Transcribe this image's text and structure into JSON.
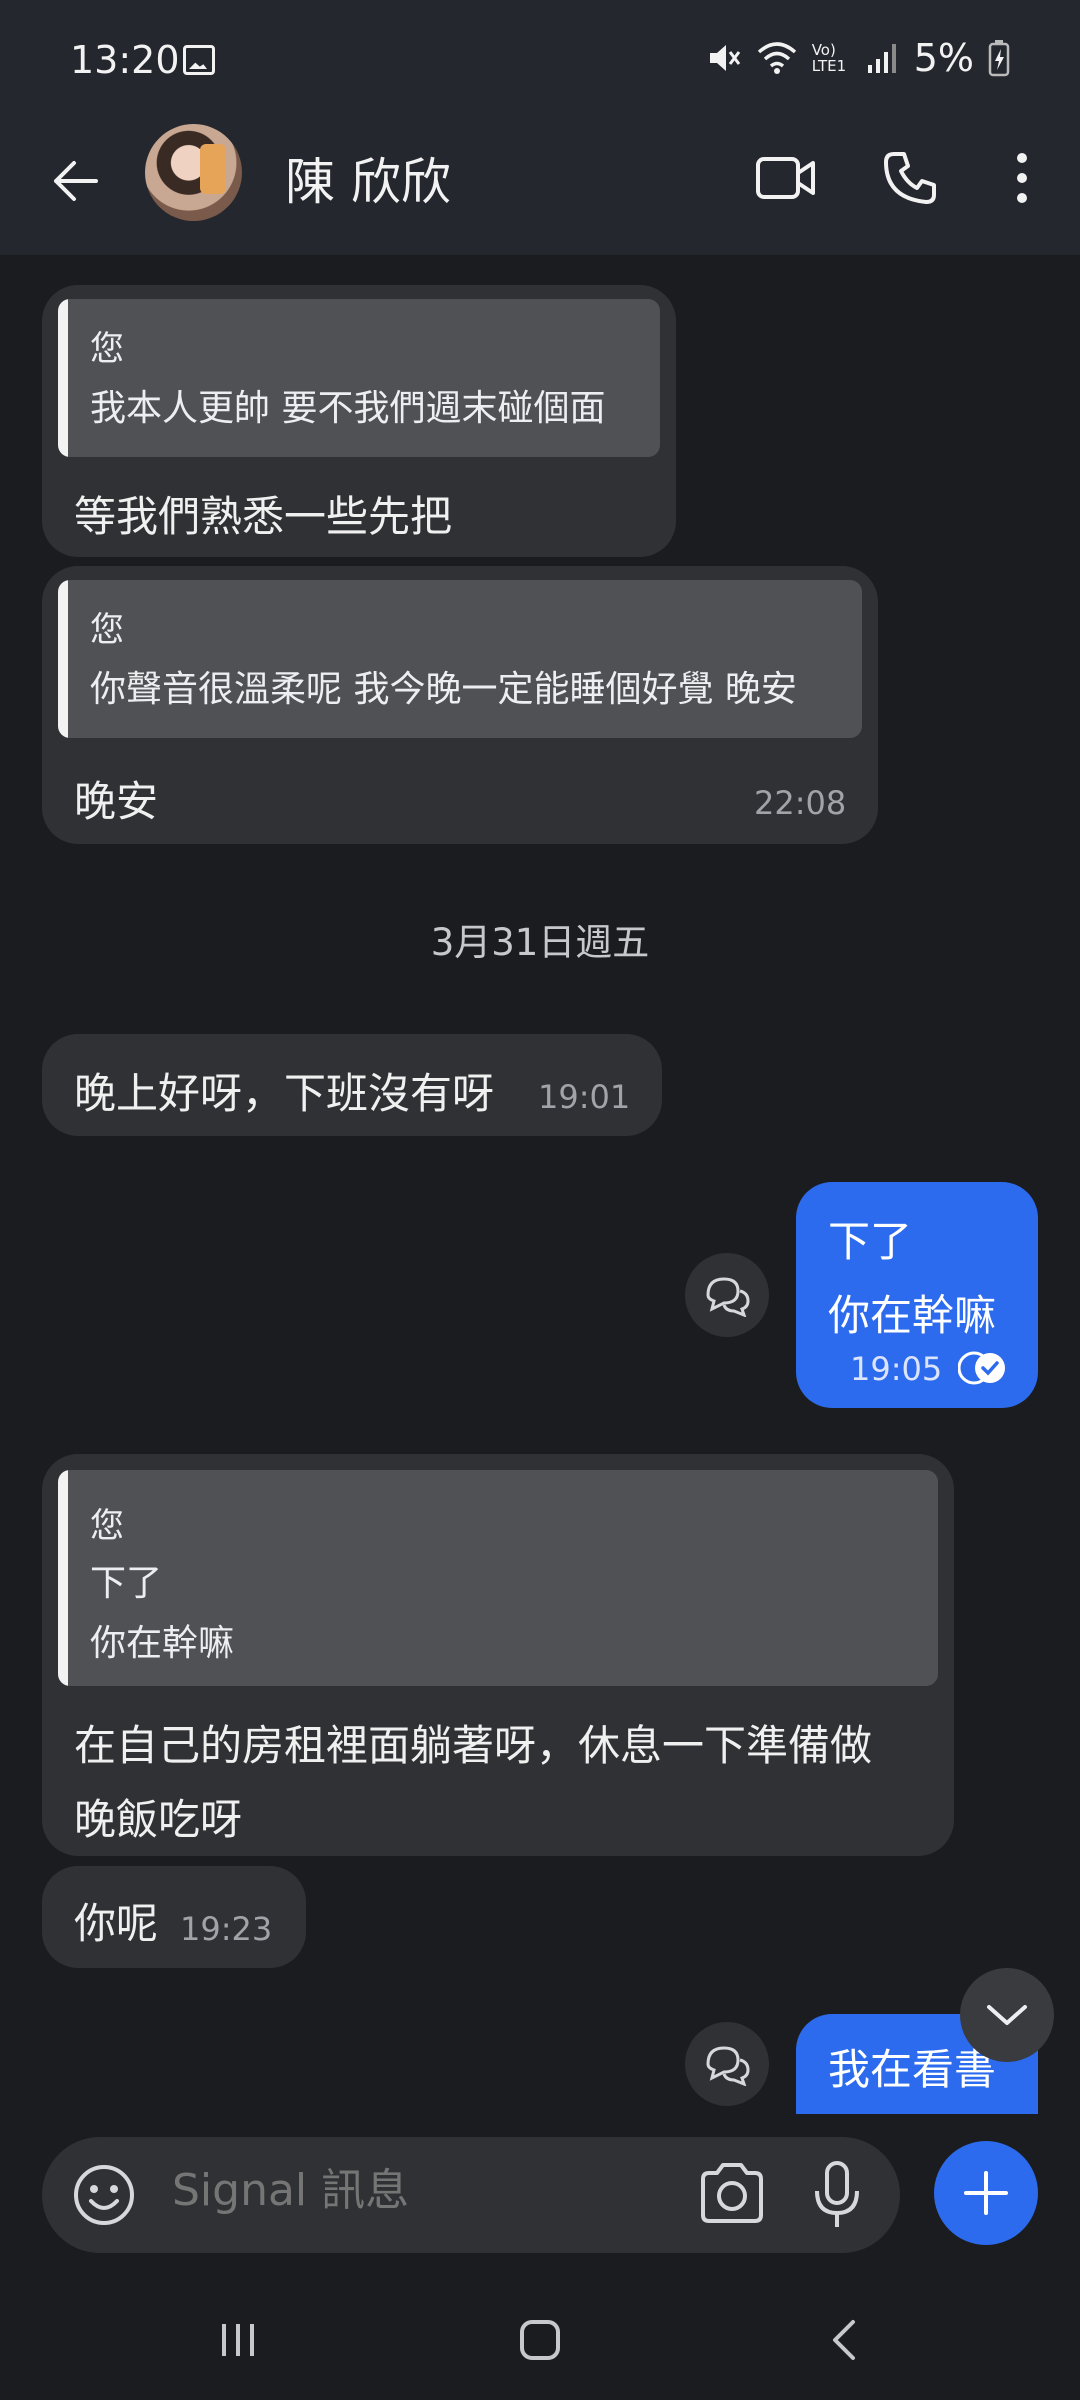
{
  "status_bar": {
    "time": "13:20",
    "battery": "5%",
    "network": "Vo) LTE1"
  },
  "header": {
    "contact_name": "陳 欣欣"
  },
  "messages": {
    "m1": {
      "quote_author": "您",
      "quote_text": "我本人更帥 要不我們週末碰個面",
      "text": "等我們熟悉一些先把"
    },
    "m2": {
      "quote_author": "您",
      "quote_text": "你聲音很溫柔呢 我今晚一定能睡個好覺 晚安",
      "text": "晚安",
      "time": "22:08"
    },
    "date_separator": "3月31日週五",
    "m3": {
      "text": "晚上好呀，下班沒有呀",
      "time": "19:01"
    },
    "m4": {
      "line1": "下了",
      "line2": "你在幹嘛",
      "time": "19:05"
    },
    "m5": {
      "quote_author": "您",
      "quote_line1": "下了",
      "quote_line2": "你在幹嘛",
      "text_line1": "在自己的房租裡面躺著呀，休息一下準備做",
      "text_line2": "晚飯吃呀"
    },
    "m6": {
      "text": "你呢",
      "time": "19:23"
    },
    "m7": {
      "text": "我在看書"
    }
  },
  "composer": {
    "placeholder": "Signal 訊息"
  },
  "colors": {
    "accent": "#2c6bed",
    "incoming_bubble": "#303134",
    "background": "#1b1c1f",
    "header": "#24272d"
  },
  "icons": [
    "back-arrow-icon",
    "video-call-icon",
    "phone-icon",
    "more-options-icon",
    "reaction-icon",
    "chevron-down-icon",
    "emoji-icon",
    "camera-icon",
    "microphone-icon",
    "plus-icon",
    "recents-icon",
    "home-icon",
    "nav-back-icon",
    "mute-icon",
    "wifi-icon",
    "signal-icon",
    "battery-icon",
    "gallery-icon"
  ]
}
